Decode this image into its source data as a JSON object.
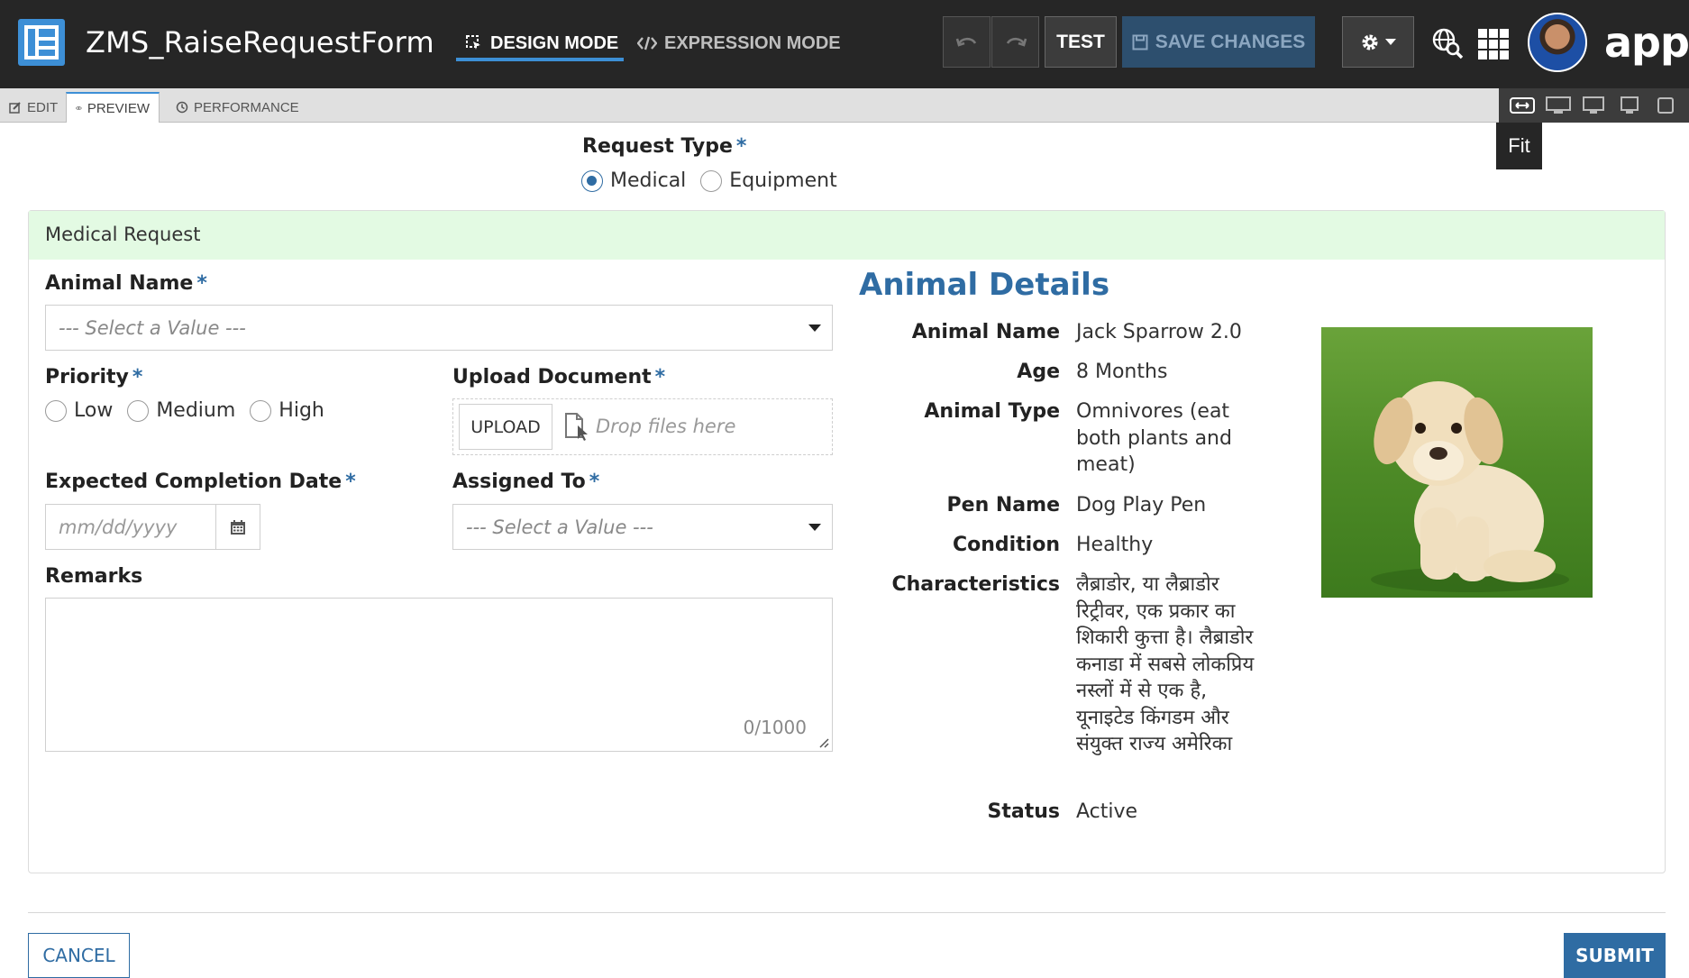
{
  "app": {
    "title": "ZMS_RaiseRequestForm",
    "brand": "appia",
    "colors": {
      "accent": "#3d8fd6",
      "primary": "#2f6ca3",
      "topbar": "#262626",
      "section_header": "#e3fae3"
    }
  },
  "header": {
    "modes": {
      "design": "DESIGN MODE",
      "expression": "EXPRESSION MODE"
    },
    "test_label": "TEST",
    "save_label": "SAVE CHANGES"
  },
  "subbar": {
    "tabs": {
      "edit": "EDIT",
      "preview": "PREVIEW",
      "performance": "PERFORMANCE"
    },
    "fit_tooltip": "Fit"
  },
  "form": {
    "request_type": {
      "label": "Request Type",
      "required": "*",
      "options": [
        "Medical",
        "Equipment"
      ],
      "selected": "Medical"
    },
    "section_title": "Medical Request",
    "animal_name": {
      "label": "Animal Name",
      "required": "*",
      "placeholder": "--- Select a Value ---"
    },
    "priority": {
      "label": "Priority",
      "required": "*",
      "options": [
        "Low",
        "Medium",
        "High"
      ]
    },
    "upload": {
      "label": "Upload Document",
      "required": "*",
      "button": "UPLOAD",
      "drop_text": "Drop files here"
    },
    "completion_date": {
      "label": "Expected Completion Date",
      "required": "*",
      "placeholder": "mm/dd/yyyy"
    },
    "assigned_to": {
      "label": "Assigned To",
      "required": "*",
      "placeholder": "--- Select a Value ---"
    },
    "remarks": {
      "label": "Remarks",
      "char_count": "0/1000"
    }
  },
  "details": {
    "title": "Animal Details",
    "rows": [
      {
        "label": "Animal Name",
        "value": "Jack Sparrow 2.0"
      },
      {
        "label": "Age",
        "value": "8 Months"
      },
      {
        "label": "Animal Type",
        "value": "Omnivores (eat both plants and meat)"
      },
      {
        "label": "Pen Name",
        "value": "Dog Play Pen"
      },
      {
        "label": "Condition",
        "value": "Healthy"
      },
      {
        "label": "Characteristics",
        "value": "लैब्राडोर, या लैब्राडोर रिट्रीवर, एक प्रकार का शिकारी कुत्ता है। लैब्राडोर कनाडा में सबसे लोकप्रिय नस्लों में से एक है, यूनाइटेड किंगडम और संयुक्त राज्य अमेरिका"
      },
      {
        "label": "Status",
        "value": "Active"
      }
    ]
  },
  "footer": {
    "cancel": "CANCEL",
    "submit": "SUBMIT"
  }
}
